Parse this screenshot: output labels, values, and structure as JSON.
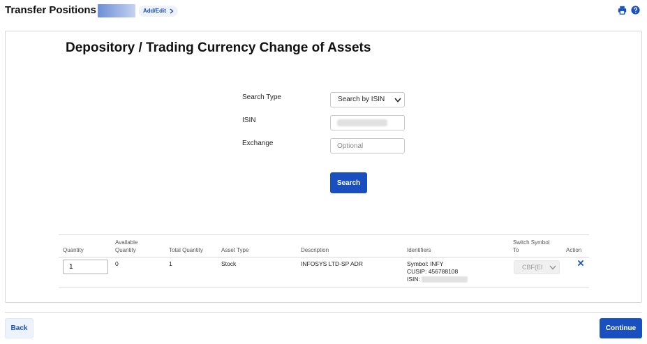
{
  "header": {
    "title": "Transfer Positions",
    "add_edit_label": "Add/Edit",
    "icons": [
      "print-icon",
      "help-icon"
    ]
  },
  "form": {
    "title": "Depository / Trading Currency Change of Assets",
    "search_type_label": "Search Type",
    "search_type_value": "Search by ISIN",
    "isin_label": "ISIN",
    "exchange_label": "Exchange",
    "exchange_placeholder": "Optional",
    "search_button": "Search"
  },
  "table": {
    "headers": {
      "quantity": "Quantity",
      "available_quantity_1": "Available",
      "available_quantity_2": "Quantity",
      "total_quantity": "Total Quantity",
      "asset_type": "Asset Type",
      "description": "Description",
      "identifiers": "Identifiers",
      "switch_symbol_1": "Switch Symbol",
      "switch_symbol_2": "To",
      "action": "Action"
    },
    "rows": [
      {
        "quantity": "1",
        "available_quantity": "0",
        "total_quantity": "1",
        "asset_type": "Stock",
        "description": "INFOSYS LTD-SP ADR",
        "symbol": "Symbol: INFY",
        "cusip": "CUSIP: 456788108",
        "isin": "ISIN:",
        "switch_symbol": "CBF(EI"
      }
    ]
  },
  "footer": {
    "back_button": "Back",
    "continue_button": "Continue"
  },
  "colors": {
    "accent": "#1a4fbf",
    "border": "#d6d6d6"
  }
}
